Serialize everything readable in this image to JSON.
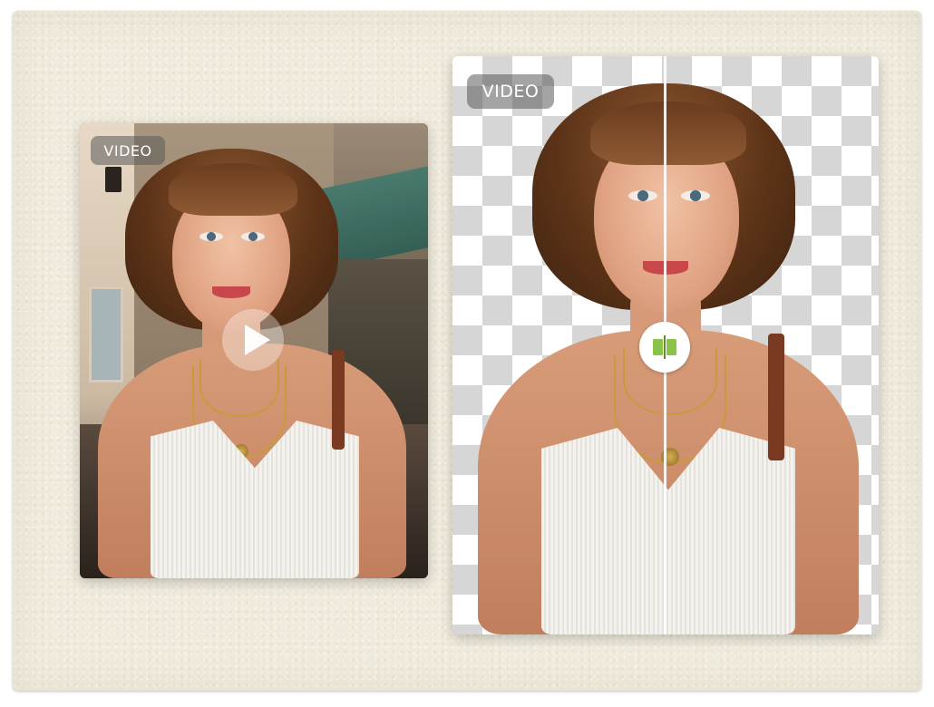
{
  "left_card": {
    "badge": "VIDEO",
    "play_icon": "play-icon"
  },
  "right_card": {
    "badge": "VIDEO",
    "compare_icon": "compare-slider-icon",
    "background": "transparent-checkerboard"
  },
  "colors": {
    "canvas": "#efeadb",
    "badge_bg": "#5a5a5a",
    "handle_accent": "#8bc34a",
    "checker_dark": "#d6d6d6",
    "checker_light": "#ffffff"
  }
}
